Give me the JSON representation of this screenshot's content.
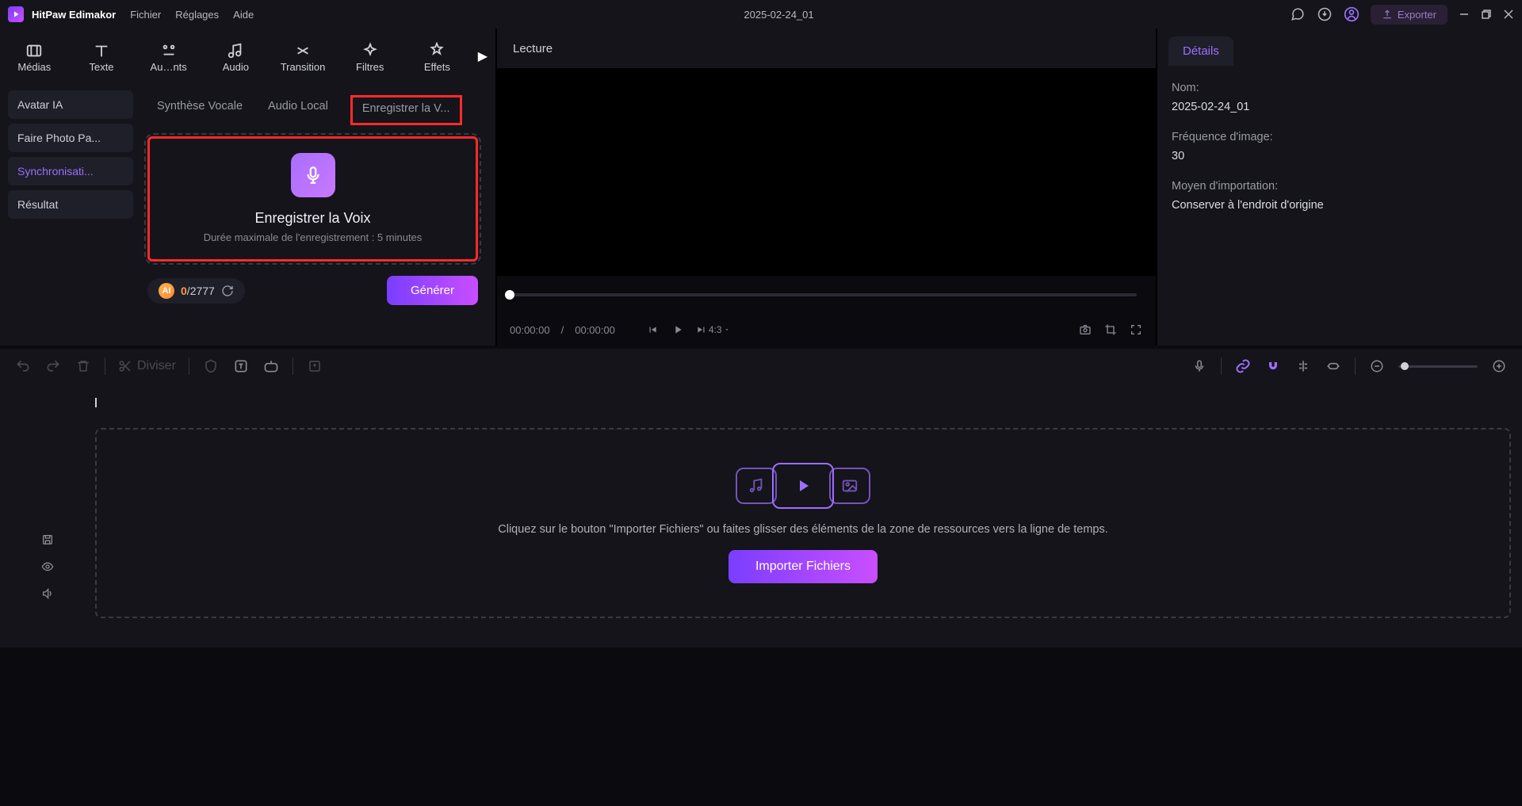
{
  "app": {
    "name": "HitPaw Edimakor"
  },
  "menu": [
    "Fichier",
    "Réglages",
    "Aide"
  ],
  "project_title": "2025-02-24_01",
  "export_label": "Exporter",
  "tool_tabs": [
    {
      "label": "Médias"
    },
    {
      "label": "Texte"
    },
    {
      "label": "Au…nts"
    },
    {
      "label": "Audio"
    },
    {
      "label": "Transition"
    },
    {
      "label": "Filtres"
    },
    {
      "label": "Effets"
    }
  ],
  "sidebar_items": [
    {
      "label": "Avatar IA",
      "active": false
    },
    {
      "label": "Faire Photo Pa...",
      "active": false
    },
    {
      "label": "Synchronisati...",
      "active": true
    },
    {
      "label": "Résultat",
      "active": false
    }
  ],
  "audio_tabs": {
    "a": "Synthèse Vocale",
    "b": "Audio Local",
    "c": "Enregistrer la V..."
  },
  "record": {
    "title": "Enregistrer la Voix",
    "subtitle": "Durée maximale de l'enregistrement : 5 minutes"
  },
  "credits": {
    "used": "0",
    "sep": "/",
    "total": "2777"
  },
  "generate_label": "Générer",
  "preview": {
    "title": "Lecture",
    "time_cur": "00:00:00",
    "time_sep": " / ",
    "time_total": "00:00:00",
    "ratio": "4:3"
  },
  "details": {
    "tab_label": "Détails",
    "name_label": "Nom:",
    "name_value": "2025-02-24_01",
    "fps_label": "Fréquence d'image:",
    "fps_value": "30",
    "import_label": "Moyen d'importation:",
    "import_value": "Conserver à l'endroit d'origine"
  },
  "split_label": "Diviser",
  "dropzone": {
    "text": "Cliquez sur le bouton \"Importer Fichiers\" ou faites glisser des éléments de la zone de ressources vers la ligne de temps.",
    "button": "Importer Fichiers"
  }
}
